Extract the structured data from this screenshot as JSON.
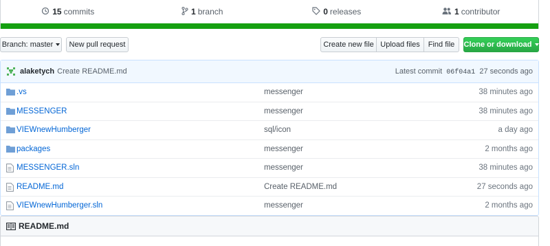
{
  "summary": {
    "commits": {
      "count": "15",
      "label": "commits",
      "icon": "history-icon"
    },
    "branches": {
      "count": "1",
      "label": "branch",
      "icon": "branch-icon"
    },
    "releases": {
      "count": "0",
      "label": "releases",
      "icon": "tag-icon"
    },
    "contributors": {
      "count": "1",
      "label": "contributor",
      "icon": "people-icon"
    }
  },
  "colors": {
    "language_bar": "#15a011",
    "link": "#0366d6",
    "clone_button": "#28a745"
  },
  "toolbar": {
    "branch_label": "Branch:",
    "branch_value": "master",
    "new_pull_request": "New pull request",
    "create_new_file": "Create new file",
    "upload_files": "Upload files",
    "find_file": "Find file",
    "clone_or_download": "Clone or download"
  },
  "latest_commit": {
    "author": "alaketych",
    "message": "Create README.md",
    "prefix": "Latest commit",
    "sha": "06f04a1",
    "age": "27 seconds ago"
  },
  "files": [
    {
      "type": "folder",
      "name": ".vs",
      "message": "messenger",
      "age": "38 minutes ago"
    },
    {
      "type": "folder",
      "name": "MESSENGER",
      "message": "messenger",
      "age": "38 minutes ago"
    },
    {
      "type": "folder",
      "name": "VIEWnewHumberger",
      "message": "sql/icon",
      "age": "a day ago"
    },
    {
      "type": "folder",
      "name": "packages",
      "message": "messenger",
      "age": "2 months ago"
    },
    {
      "type": "file",
      "name": "MESSENGER.sln",
      "message": "messenger",
      "age": "38 minutes ago"
    },
    {
      "type": "file",
      "name": "README.md",
      "message": "Create README.md",
      "age": "27 seconds ago"
    },
    {
      "type": "file",
      "name": "VIEWnewHumberger.sln",
      "message": "messenger",
      "age": "2 months ago"
    }
  ],
  "readme": {
    "title": "README.md",
    "icon": "book-icon"
  }
}
